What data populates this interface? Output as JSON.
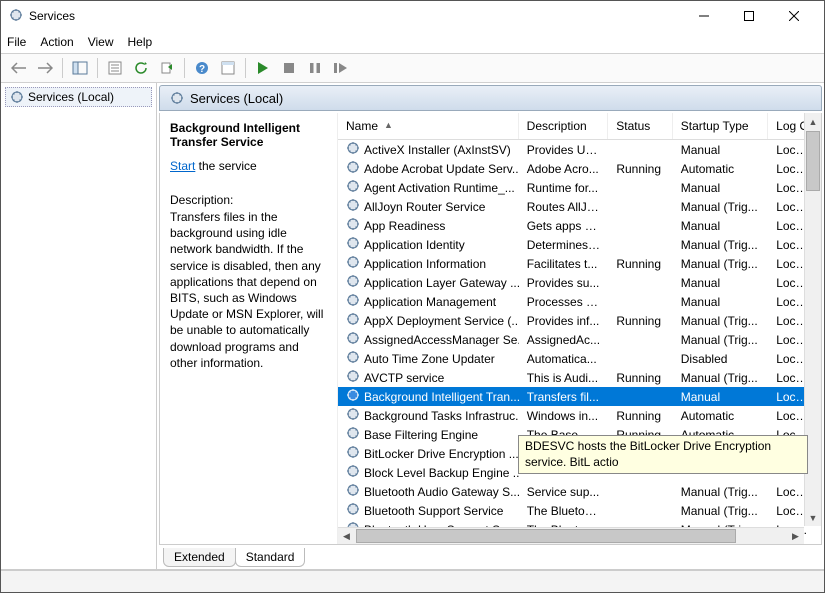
{
  "window": {
    "title": "Services"
  },
  "menu": {
    "file": "File",
    "action": "Action",
    "view": "View",
    "help": "Help"
  },
  "tree": {
    "root": "Services (Local)"
  },
  "pane_header": "Services (Local)",
  "tabs": {
    "extended": "Extended",
    "standard": "Standard"
  },
  "details": {
    "title": "Background Intelligent Transfer Service",
    "start_link": "Start",
    "start_rest": " the service",
    "desc_label": "Description:",
    "desc_text": "Transfers files in the background using idle network bandwidth. If the service is disabled, then any applications that depend on BITS, such as Windows Update or MSN Explorer, will be unable to automatically download programs and other information."
  },
  "columns": {
    "name": "Name",
    "description": "Description",
    "status": "Status",
    "startup": "Startup Type",
    "logon": "Log On"
  },
  "tooltip": "BDESVC hosts the BitLocker Drive Encryption service. BitL actio",
  "services": [
    {
      "name": "ActiveX Installer (AxInstSV)",
      "desc": "Provides Us...",
      "status": "",
      "startup": "Manual",
      "logon": "Local Sy"
    },
    {
      "name": "Adobe Acrobat Update Serv...",
      "desc": "Adobe Acro...",
      "status": "Running",
      "startup": "Automatic",
      "logon": "Local Sy"
    },
    {
      "name": "Agent Activation Runtime_...",
      "desc": "Runtime for...",
      "status": "",
      "startup": "Manual",
      "logon": "Local Sy"
    },
    {
      "name": "AllJoyn Router Service",
      "desc": "Routes AllJo...",
      "status": "",
      "startup": "Manual (Trig...",
      "logon": "Local Se"
    },
    {
      "name": "App Readiness",
      "desc": "Gets apps re...",
      "status": "",
      "startup": "Manual",
      "logon": "Local Sy"
    },
    {
      "name": "Application Identity",
      "desc": "Determines ...",
      "status": "",
      "startup": "Manual (Trig...",
      "logon": "Local Se"
    },
    {
      "name": "Application Information",
      "desc": "Facilitates t...",
      "status": "Running",
      "startup": "Manual (Trig...",
      "logon": "Local Sy"
    },
    {
      "name": "Application Layer Gateway ...",
      "desc": "Provides su...",
      "status": "",
      "startup": "Manual",
      "logon": "Local Se"
    },
    {
      "name": "Application Management",
      "desc": "Processes in...",
      "status": "",
      "startup": "Manual",
      "logon": "Local Sy"
    },
    {
      "name": "AppX Deployment Service (...",
      "desc": "Provides inf...",
      "status": "Running",
      "startup": "Manual (Trig...",
      "logon": "Local Sy"
    },
    {
      "name": "AssignedAccessManager Se...",
      "desc": "AssignedAc...",
      "status": "",
      "startup": "Manual (Trig...",
      "logon": "Local Sy"
    },
    {
      "name": "Auto Time Zone Updater",
      "desc": "Automatica...",
      "status": "",
      "startup": "Disabled",
      "logon": "Local Se"
    },
    {
      "name": "AVCTP service",
      "desc": "This is Audi...",
      "status": "Running",
      "startup": "Manual (Trig...",
      "logon": "Local Se"
    },
    {
      "name": "Background Intelligent Tran...",
      "desc": "Transfers fil...",
      "status": "",
      "startup": "Manual",
      "logon": "Local Sy",
      "selected": true
    },
    {
      "name": "Background Tasks Infrastruc...",
      "desc": "Windows in...",
      "status": "Running",
      "startup": "Automatic",
      "logon": "Local Sy"
    },
    {
      "name": "Base Filtering Engine",
      "desc": "The Base Fil...",
      "status": "Running",
      "startup": "Automatic",
      "logon": "Local Se"
    },
    {
      "name": "BitLocker Drive Encryption ...",
      "desc": "",
      "status": "",
      "startup": "",
      "logon": ""
    },
    {
      "name": "Block Level Backup Engine ...",
      "desc": "",
      "status": "",
      "startup": "",
      "logon": ""
    },
    {
      "name": "Bluetooth Audio Gateway S...",
      "desc": "Service sup...",
      "status": "",
      "startup": "Manual (Trig...",
      "logon": "Local Se"
    },
    {
      "name": "Bluetooth Support Service",
      "desc": "The Bluetoo...",
      "status": "",
      "startup": "Manual (Trig...",
      "logon": "Local Se"
    },
    {
      "name": "Bluetooth User Support Ser...",
      "desc": "The Bluetoo...",
      "status": "",
      "startup": "Manual (Trig...",
      "logon": "Local Sy"
    }
  ]
}
